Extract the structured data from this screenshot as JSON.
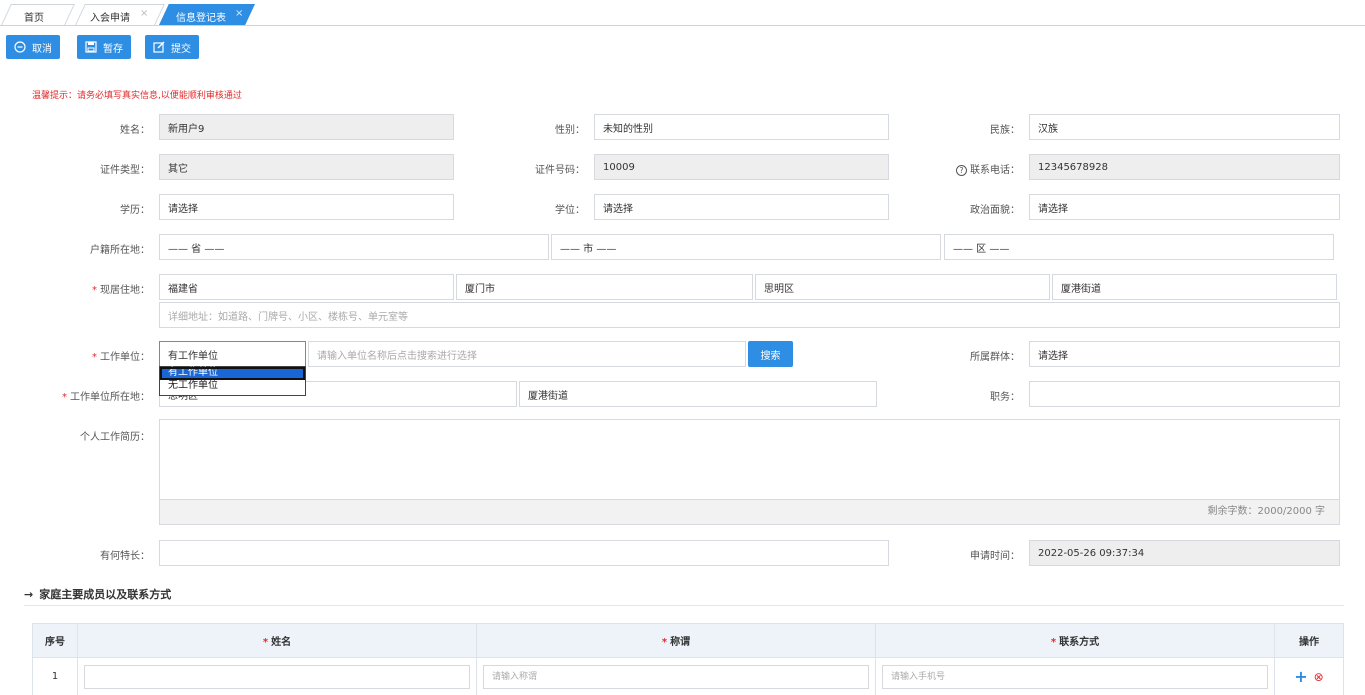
{
  "tabs": [
    {
      "label": "首页"
    },
    {
      "label": "入会申请",
      "close": "×"
    },
    {
      "label": "信息登记表",
      "close": "×"
    }
  ],
  "toolbar": {
    "cancel": "取消",
    "save_draft": "暂存",
    "submit": "提交"
  },
  "hint": "温馨提示：请务必填写真实信息,以便能顺利审核通过",
  "labels": {
    "name": "姓名：",
    "gender": "性别：",
    "ethnicity": "民族：",
    "id_type": "证件类型：",
    "id_number": "证件号码：",
    "phone": "联系电话：",
    "education": "学历：",
    "degree": "学位：",
    "politics": "政治面貌：",
    "household": "户籍所在地：",
    "residence": "现居住地：",
    "workplace": "工作单位：",
    "group": "所属群体：",
    "work_location": "工作单位所在地：",
    "position": "职务：",
    "resume": "个人工作简历：",
    "specialty": "有何特长：",
    "apply_time": "申请时间："
  },
  "values": {
    "name": "新用户9",
    "gender": "未知的性别",
    "ethnicity": "汉族",
    "id_type": "其它",
    "id_number": "10009",
    "phone": "12345678928",
    "education": "请选择",
    "degree": "请选择",
    "politics": "请选择",
    "household_province": "—— 省 ——",
    "household_city": "—— 市 ——",
    "household_district": "—— 区 ——",
    "res_province": "福建省",
    "res_city": "厦门市",
    "res_district": "思明区",
    "res_street": "厦港街道",
    "res_detail_placeholder": "详细地址：如道路、门牌号、小区、楼栋号、单元室等",
    "workplace_select": "有工作单位",
    "workplace_search_placeholder": "请输入单位名称后点击搜索进行选择",
    "search_btn": "搜索",
    "group": "请选择",
    "work_district": "思明区",
    "work_street": "厦港街道",
    "resume_counter": "剩余字数：2000/2000 字",
    "apply_time": "2022-05-26 09:37:34"
  },
  "dropdown_options": [
    "有工作单位",
    "无工作单位"
  ],
  "family": {
    "title": "家庭主要成员以及联系方式",
    "columns": {
      "index": "序号",
      "name": "姓名",
      "relation": "称谓",
      "contact": "联系方式",
      "ops": "操作"
    },
    "rows": [
      {
        "index": "1",
        "relation_ph": "请输入称谓",
        "contact_ph": "请输入手机号"
      }
    ]
  },
  "colors": {
    "primary": "#2e8ee4",
    "required": "#e02b2b"
  }
}
